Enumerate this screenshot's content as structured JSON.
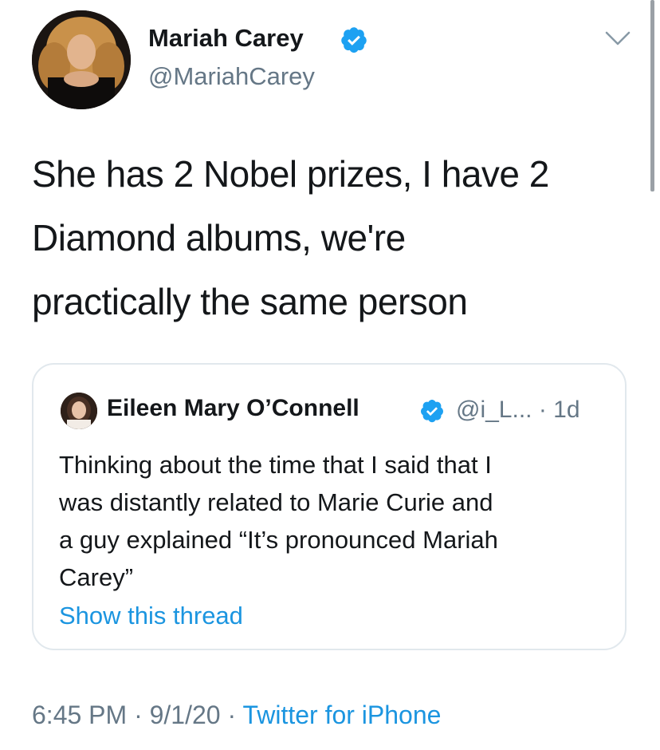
{
  "author": {
    "name": "Mariah Carey",
    "handle": "@MariahCarey",
    "verified": true
  },
  "tweet": {
    "text_lines": [
      "She has 2 Nobel prizes, I have 2",
      "Diamond albums, we're",
      "practically the same person"
    ]
  },
  "quoted_tweet": {
    "author_name": "Eileen Mary O’Connell",
    "handle": "@i_L...",
    "time": "· 1d",
    "verified": true,
    "text_lines": [
      "Thinking about the time that I said that I",
      "was distantly related to Marie Curie and",
      "a guy explained “It’s pronounced Mariah",
      "Carey”"
    ],
    "show_thread_label": "Show this thread"
  },
  "footer": {
    "time": "6:45 PM",
    "date": "9/1/20",
    "separator": " · ",
    "source": "Twitter for iPhone"
  },
  "colors": {
    "text": "#14171a",
    "secondary": "#657786",
    "link": "#1b95e0",
    "verified": "#1da1f2",
    "border": "#e1e8ed"
  },
  "icons": {
    "verified": "verified-badge-icon",
    "caret": "chevron-down-icon"
  }
}
